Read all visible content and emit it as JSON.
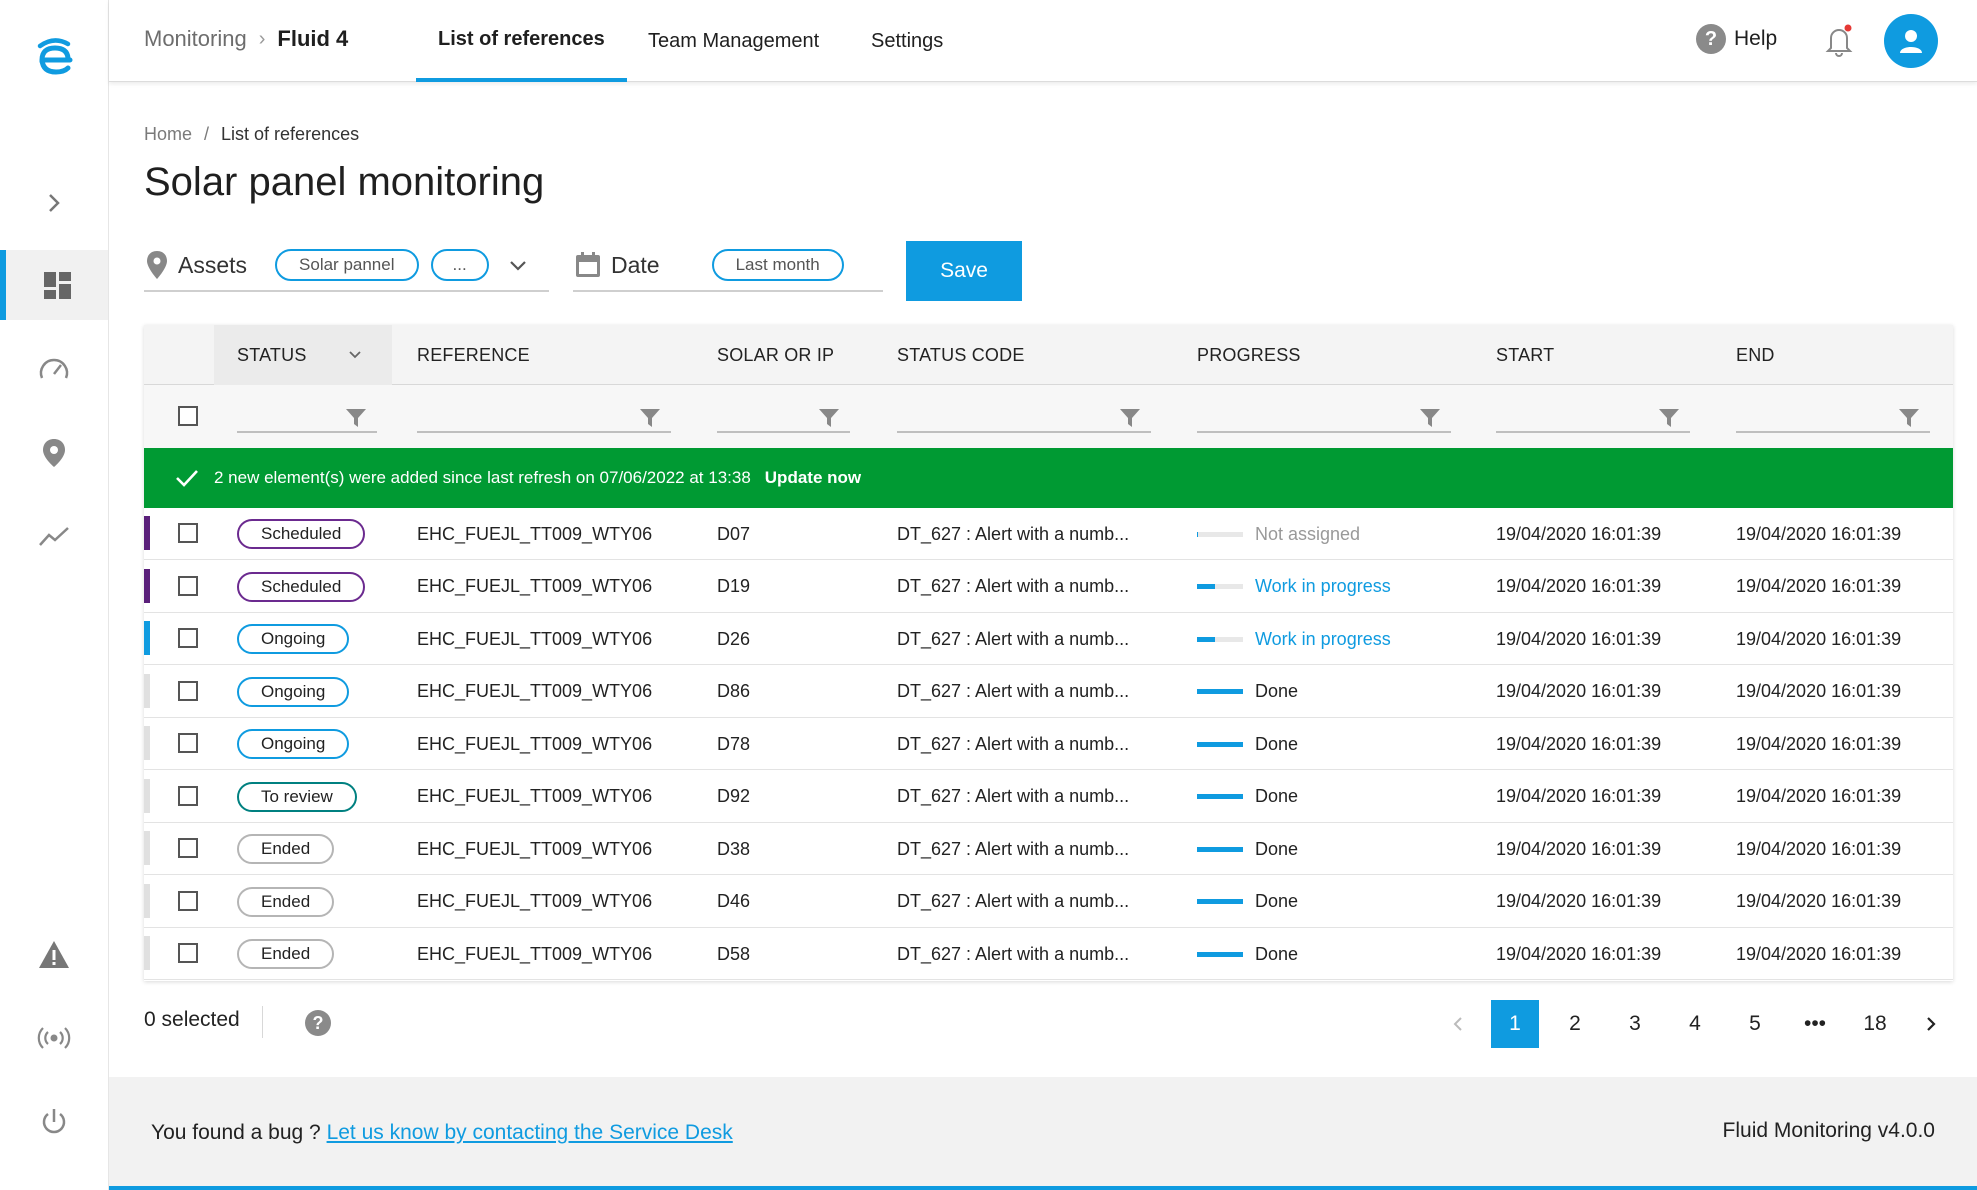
{
  "app": {
    "section": "Monitoring",
    "product": "Fluid 4"
  },
  "nav": {
    "tabs": [
      {
        "label": "List of references"
      },
      {
        "label": "Team Management"
      },
      {
        "label": "Settings"
      }
    ],
    "help_label": "Help"
  },
  "breadcrumb": {
    "home": "Home",
    "separator": "/",
    "current": "List of references"
  },
  "page": {
    "title": "Solar panel monitoring"
  },
  "filters": {
    "assets_label": "Assets",
    "assets_chip": "Solar pannel",
    "assets_more": "...",
    "date_label": "Date",
    "date_chip": "Last month",
    "save_label": "Save"
  },
  "table": {
    "columns": [
      "STATUS",
      "REFERENCE",
      "SOLAR OR IP",
      "STATUS CODE",
      "PROGRESS",
      "START",
      "END"
    ],
    "banner": {
      "message": "2 new element(s) were added since last refresh on 07/06/2022 at 13:38",
      "action": "Update now"
    },
    "rows": [
      {
        "status": "Scheduled",
        "reference": "EHC_FUEJL_TT009_WTY06",
        "solar_or_ip": "D07",
        "status_code": "DT_627 : Alert with a numb...",
        "progress": "Not assigned",
        "progress_pct": 0.03,
        "start": "19/04/2020 16:01:39",
        "end": "19/04/2020 16:01:39"
      },
      {
        "status": "Scheduled",
        "reference": "EHC_FUEJL_TT009_WTY06",
        "solar_or_ip": "D19",
        "status_code": "DT_627 : Alert with a numb...",
        "progress": "Work in progress",
        "progress_pct": 0.4,
        "start": "19/04/2020 16:01:39",
        "end": "19/04/2020 16:01:39"
      },
      {
        "status": "Ongoing",
        "reference": "EHC_FUEJL_TT009_WTY06",
        "solar_or_ip": "D26",
        "status_code": "DT_627 : Alert with a numb...",
        "progress": "Work in progress",
        "progress_pct": 0.4,
        "start": "19/04/2020 16:01:39",
        "end": "19/04/2020 16:01:39"
      },
      {
        "status": "Ongoing",
        "reference": "EHC_FUEJL_TT009_WTY06",
        "solar_or_ip": "D86",
        "status_code": "DT_627 : Alert with a numb...",
        "progress": "Done",
        "progress_pct": 1,
        "start": "19/04/2020 16:01:39",
        "end": "19/04/2020 16:01:39"
      },
      {
        "status": "Ongoing",
        "reference": "EHC_FUEJL_TT009_WTY06",
        "solar_or_ip": "D78",
        "status_code": "DT_627 : Alert with a numb...",
        "progress": "Done",
        "progress_pct": 1,
        "start": "19/04/2020 16:01:39",
        "end": "19/04/2020 16:01:39"
      },
      {
        "status": "To review",
        "reference": "EHC_FUEJL_TT009_WTY06",
        "solar_or_ip": "D92",
        "status_code": "DT_627 : Alert with a numb...",
        "progress": "Done",
        "progress_pct": 1,
        "start": "19/04/2020 16:01:39",
        "end": "19/04/2020 16:01:39"
      },
      {
        "status": "Ended",
        "reference": "EHC_FUEJL_TT009_WTY06",
        "solar_or_ip": "D38",
        "status_code": "DT_627 : Alert with a numb...",
        "progress": "Done",
        "progress_pct": 1,
        "start": "19/04/2020 16:01:39",
        "end": "19/04/2020 16:01:39"
      },
      {
        "status": "Ended",
        "reference": "EHC_FUEJL_TT009_WTY06",
        "solar_or_ip": "D46",
        "status_code": "DT_627 : Alert with a numb...",
        "progress": "Done",
        "progress_pct": 1,
        "start": "19/04/2020 16:01:39",
        "end": "19/04/2020 16:01:39"
      },
      {
        "status": "Ended",
        "reference": "EHC_FUEJL_TT009_WTY06",
        "solar_or_ip": "D58",
        "status_code": "DT_627 : Alert with a numb...",
        "progress": "Done",
        "progress_pct": 1,
        "start": "19/04/2020 16:01:39",
        "end": "19/04/2020 16:01:39"
      }
    ]
  },
  "status_colors": {
    "Scheduled": "#6b2a8f",
    "Ongoing": "#0f9be0",
    "To review": "#008080",
    "Ended": "#b5b5b5"
  },
  "row_markers": [
    "#5a1f7a",
    "#5a1f7a",
    "#0f9be0",
    "#e0e0e0",
    "#e0e0e0",
    "#e0e0e0",
    "#e0e0e0",
    "#e0e0e0",
    "#e0e0e0"
  ],
  "pagination": {
    "selected": "0 selected",
    "help_icon": "?",
    "pages": [
      "1",
      "2",
      "3",
      "4",
      "5",
      "•••",
      "18"
    ],
    "current": "1"
  },
  "footer": {
    "bug_text": "You found a bug ? ",
    "bug_link": "Let us know by contacting the Service Desk",
    "version": "Fluid Monitoring v4.0.0"
  },
  "colors": {
    "accent": "#0f9be0",
    "banner": "#009a33"
  }
}
